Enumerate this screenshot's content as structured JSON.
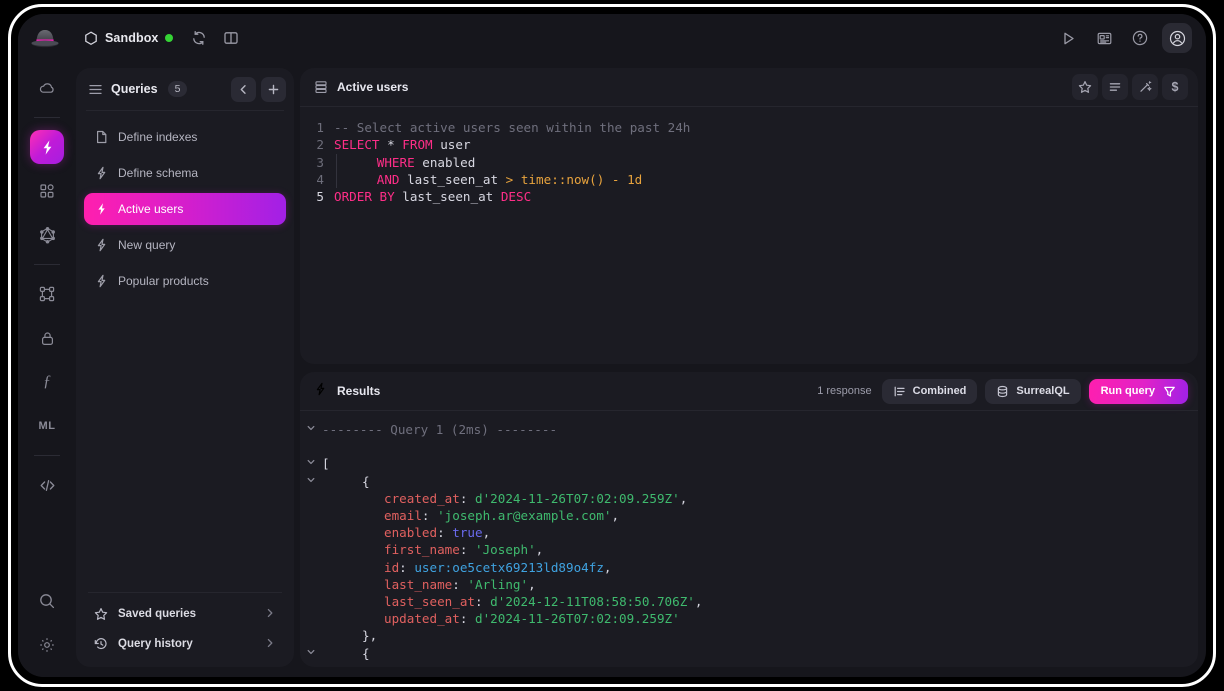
{
  "topbar": {
    "logo_icon": "bowler-hat-logo",
    "instance_icon": "hexagon-icon",
    "instance_name": "Sandbox",
    "status": "connected",
    "status_color": "#35d435",
    "reconnect_icon": "refresh-icon",
    "layout_icon": "panel-layout-icon",
    "run_icon": "play-icon",
    "news_icon": "news-icon",
    "help_icon": "question-circle-icon",
    "account_icon": "user-circle-icon"
  },
  "rail": {
    "items": [
      {
        "name": "cloud",
        "icon": "cloud-icon",
        "label": ""
      },
      {
        "name": "query",
        "icon": "lightning-icon",
        "label": "",
        "active": true
      },
      {
        "name": "explorer",
        "icon": "grid-squares-icon",
        "label": ""
      },
      {
        "name": "graphql",
        "icon": "graphql-icon",
        "label": ""
      },
      {
        "name": "graph",
        "icon": "relations-graph-icon",
        "label": ""
      },
      {
        "name": "authentication",
        "icon": "lock-icon",
        "label": ""
      },
      {
        "name": "functions",
        "icon": "function-icon",
        "label": "ƒ"
      },
      {
        "name": "models",
        "icon": "ml-icon",
        "label": "ML"
      },
      {
        "name": "api-docs",
        "icon": "code-brackets-icon",
        "label": ""
      }
    ],
    "bottom": [
      {
        "name": "search",
        "icon": "search-icon"
      },
      {
        "name": "settings",
        "icon": "gear-icon"
      }
    ]
  },
  "queries": {
    "menu_icon": "list-icon",
    "title": "Queries",
    "count": "5",
    "collapse_icon": "chevron-left-icon",
    "add_icon": "plus-icon",
    "items": [
      {
        "label": "Define indexes",
        "icon": "file-icon",
        "active": false
      },
      {
        "label": "Define schema",
        "icon": "lightning-icon",
        "active": false
      },
      {
        "label": "Active users",
        "icon": "lightning-icon",
        "active": true
      },
      {
        "label": "New query",
        "icon": "lightning-icon",
        "active": false
      },
      {
        "label": "Popular products",
        "icon": "lightning-icon",
        "active": false
      }
    ],
    "footer": [
      {
        "label": "Saved queries",
        "icon": "star-icon",
        "chevron": "chevron-right-icon"
      },
      {
        "label": "Query history",
        "icon": "history-icon",
        "chevron": "chevron-right-icon"
      }
    ]
  },
  "editor": {
    "tab_icon": "stack-icon",
    "tab_title": "Active users",
    "tools": [
      {
        "name": "save-query",
        "icon": "star-icon"
      },
      {
        "name": "format-query",
        "icon": "format-lines-icon"
      },
      {
        "name": "infer-query",
        "icon": "magic-wand-icon"
      },
      {
        "name": "query-variables",
        "icon": "dollar-icon"
      }
    ],
    "lines": [
      {
        "n": "1",
        "tokens": [
          {
            "t": "-- Select active users seen within the past 24h",
            "c": "cm"
          }
        ]
      },
      {
        "n": "2",
        "tokens": [
          {
            "t": "SELECT",
            "c": "kw"
          },
          {
            "t": " ",
            "c": ""
          },
          {
            "t": "*",
            "c": "star"
          },
          {
            "t": " ",
            "c": ""
          },
          {
            "t": "FROM",
            "c": "kw"
          },
          {
            "t": " user",
            "c": "code-txt"
          }
        ]
      },
      {
        "n": "3",
        "indent": 1,
        "tokens": [
          {
            "t": "    ",
            "c": ""
          },
          {
            "t": "WHERE",
            "c": "kw"
          },
          {
            "t": " enabled",
            "c": "code-txt"
          }
        ]
      },
      {
        "n": "4",
        "indent": 1,
        "tokens": [
          {
            "t": "    ",
            "c": ""
          },
          {
            "t": "AND",
            "c": "kw"
          },
          {
            "t": " last_seen_at ",
            "c": "code-txt"
          },
          {
            "t": ">",
            "c": "op"
          },
          {
            "t": " ",
            "c": ""
          },
          {
            "t": "time",
            "c": "fn"
          },
          {
            "t": "::",
            "c": "op"
          },
          {
            "t": "now()",
            "c": "fn"
          },
          {
            "t": " ",
            "c": ""
          },
          {
            "t": "-",
            "c": "op"
          },
          {
            "t": " ",
            "c": ""
          },
          {
            "t": "1d",
            "c": "num"
          }
        ]
      },
      {
        "n": "5",
        "tokens": [
          {
            "t": "ORDER BY",
            "c": "kw"
          },
          {
            "t": " last_seen_at ",
            "c": "code-txt"
          },
          {
            "t": "DESC",
            "c": "kw"
          }
        ]
      }
    ]
  },
  "results": {
    "icon": "lightning-icon",
    "title": "Results",
    "response_count": "1 response",
    "mode": {
      "label": "Combined",
      "icon": "list-mode-icon"
    },
    "language": {
      "label": "SurrealQL",
      "icon": "database-icon"
    },
    "run_button": {
      "label": "Run query",
      "icon": "filter-icon"
    },
    "lines": [
      {
        "chevron": "v",
        "indent": 0,
        "tokens": [
          {
            "t": "-------- Query 1 (2ms) --------",
            "c": "dim"
          }
        ]
      },
      {
        "chevron": "",
        "indent": 0,
        "tokens": [
          {
            "t": "",
            "c": ""
          }
        ]
      },
      {
        "chevron": "v",
        "indent": 0,
        "tokens": [
          {
            "t": "[",
            "c": "punc"
          }
        ]
      },
      {
        "chevron": "v",
        "indent": 1,
        "tokens": [
          {
            "t": "{",
            "c": "punc"
          }
        ]
      },
      {
        "chevron": "",
        "indent": 2,
        "tokens": [
          {
            "t": "created_at",
            "c": "key"
          },
          {
            "t": ": ",
            "c": "punc"
          },
          {
            "t": "d'2024-11-26T07:02:09.259Z'",
            "c": "str"
          },
          {
            "t": ",",
            "c": "punc"
          }
        ]
      },
      {
        "chevron": "",
        "indent": 2,
        "tokens": [
          {
            "t": "email",
            "c": "key"
          },
          {
            "t": ": ",
            "c": "punc"
          },
          {
            "t": "'joseph.ar@example.com'",
            "c": "str"
          },
          {
            "t": ",",
            "c": "punc"
          }
        ]
      },
      {
        "chevron": "",
        "indent": 2,
        "tokens": [
          {
            "t": "enabled",
            "c": "key"
          },
          {
            "t": ": ",
            "c": "punc"
          },
          {
            "t": "true",
            "c": "bool"
          },
          {
            "t": ",",
            "c": "punc"
          }
        ]
      },
      {
        "chevron": "",
        "indent": 2,
        "tokens": [
          {
            "t": "first_name",
            "c": "key"
          },
          {
            "t": ": ",
            "c": "punc"
          },
          {
            "t": "'Joseph'",
            "c": "str"
          },
          {
            "t": ",",
            "c": "punc"
          }
        ]
      },
      {
        "chevron": "",
        "indent": 2,
        "tokens": [
          {
            "t": "id",
            "c": "key"
          },
          {
            "t": ": ",
            "c": "punc"
          },
          {
            "t": "user:oe5cetx69213ld89o4fz",
            "c": "rid"
          },
          {
            "t": ",",
            "c": "punc"
          }
        ]
      },
      {
        "chevron": "",
        "indent": 2,
        "tokens": [
          {
            "t": "last_name",
            "c": "key"
          },
          {
            "t": ": ",
            "c": "punc"
          },
          {
            "t": "'Arling'",
            "c": "str"
          },
          {
            "t": ",",
            "c": "punc"
          }
        ]
      },
      {
        "chevron": "",
        "indent": 2,
        "tokens": [
          {
            "t": "last_seen_at",
            "c": "key"
          },
          {
            "t": ": ",
            "c": "punc"
          },
          {
            "t": "d'2024-12-11T08:58:50.706Z'",
            "c": "str"
          },
          {
            "t": ",",
            "c": "punc"
          }
        ]
      },
      {
        "chevron": "",
        "indent": 2,
        "tokens": [
          {
            "t": "updated_at",
            "c": "key"
          },
          {
            "t": ": ",
            "c": "punc"
          },
          {
            "t": "d'2024-11-26T07:02:09.259Z'",
            "c": "str"
          }
        ]
      },
      {
        "chevron": "",
        "indent": 1,
        "tokens": [
          {
            "t": "},",
            "c": "punc"
          }
        ]
      },
      {
        "chevron": "v",
        "indent": 1,
        "tokens": [
          {
            "t": "{",
            "c": "punc"
          }
        ]
      }
    ]
  }
}
